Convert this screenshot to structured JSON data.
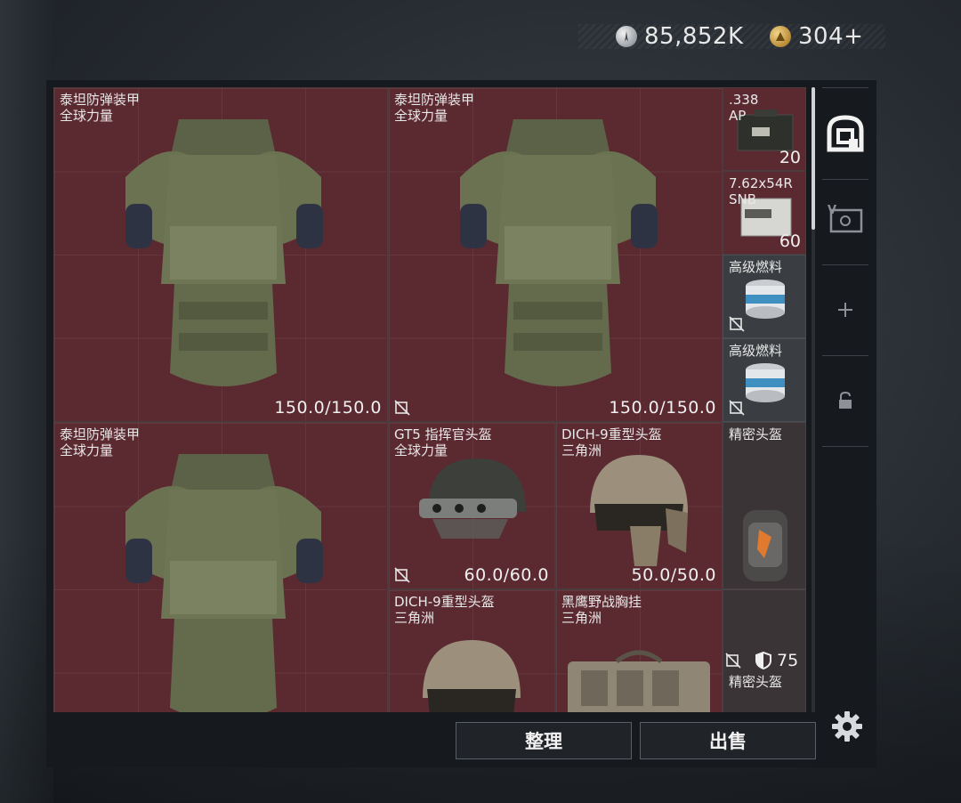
{
  "currency": {
    "silver_amount": "85,852K",
    "gold_amount": "304+"
  },
  "inventory": [
    {
      "name_line1": "泰坦防弹装甲",
      "name_line2": "全球力量",
      "durability": "150.0/150.0"
    },
    {
      "name_line1": "泰坦防弹装甲",
      "name_line2": "全球力量",
      "durability": "150.0/150.0"
    },
    {
      "name_line1": ".338",
      "name_line2": "AP",
      "quantity": "20"
    },
    {
      "name_line1": "7.62x54R",
      "name_line2": "SNB",
      "quantity": "60"
    },
    {
      "name_line1": "高级燃料"
    },
    {
      "name_line1": "高级燃料"
    },
    {
      "name_line1": "泰坦防弹装甲",
      "name_line2": "全球力量"
    },
    {
      "name_line1": "GT5 指挥官头盔",
      "name_line2": "全球力量",
      "durability": "60.0/60.0"
    },
    {
      "name_line1": "DICH-9重型头盔",
      "name_line2": "三角洲",
      "durability": "50.0/50.0"
    },
    {
      "name_line1": "精密头盔"
    },
    {
      "name_line1": "DICH-9重型头盔",
      "name_line2": "三角洲"
    },
    {
      "name_line1": "黑鹰野战胸挂",
      "name_line2": "三角洲"
    },
    {
      "name_line1": "精密头盔",
      "armor_value": "75"
    }
  ],
  "buttons": {
    "sort_label": "整理",
    "sell_label": "出售"
  },
  "sidebar": {
    "icons": [
      "backpack-icon",
      "voucher-icon",
      "plus-icon",
      "lock-icon",
      "gear-icon"
    ]
  },
  "colors": {
    "item_bg_red": "#5b2a31",
    "item_bg_dark": "#3a3d42",
    "panel_bg": "#16191d"
  }
}
